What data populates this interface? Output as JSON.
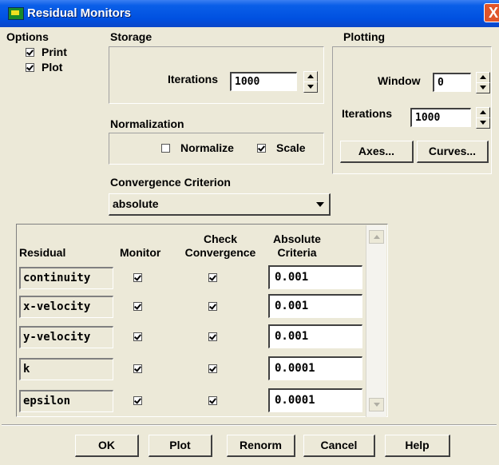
{
  "window": {
    "title": "Residual Monitors",
    "close_glyph": "X"
  },
  "options": {
    "label": "Options",
    "print": {
      "label": "Print",
      "checked": true
    },
    "plot": {
      "label": "Plot",
      "checked": true
    }
  },
  "storage": {
    "label": "Storage",
    "iterations_label": "Iterations",
    "iterations_value": "1000"
  },
  "plotting": {
    "label": "Plotting",
    "window_label": "Window",
    "window_value": "0",
    "iterations_label": "Iterations",
    "iterations_value": "1000",
    "axes_button": "Axes...",
    "curves_button": "Curves..."
  },
  "normalization": {
    "label": "Normalization",
    "normalize": {
      "label": "Normalize",
      "checked": false
    },
    "scale": {
      "label": "Scale",
      "checked": true
    }
  },
  "convergence": {
    "label": "Convergence Criterion",
    "selected": "absolute"
  },
  "table": {
    "headers": {
      "residual": "Residual",
      "monitor": "Monitor",
      "check_convergence": "Check\nConvergence",
      "absolute_criteria": "Absolute\nCriteria"
    },
    "rows": [
      {
        "name": "continuity",
        "monitor": true,
        "check": true,
        "criteria": "0.001"
      },
      {
        "name": "x-velocity",
        "monitor": true,
        "check": true,
        "criteria": "0.001"
      },
      {
        "name": "y-velocity",
        "monitor": true,
        "check": true,
        "criteria": "0.001"
      },
      {
        "name": "k",
        "monitor": true,
        "check": true,
        "criteria": "0.0001"
      },
      {
        "name": "epsilon",
        "monitor": true,
        "check": true,
        "criteria": "0.0001"
      }
    ]
  },
  "buttons": {
    "ok": "OK",
    "plot": "Plot",
    "renorm": "Renorm",
    "cancel": "Cancel",
    "help": "Help"
  },
  "colors": {
    "titlebar": "#0050e0",
    "dialog_bg": "#ece9d8",
    "close_button": "#e0552b"
  }
}
